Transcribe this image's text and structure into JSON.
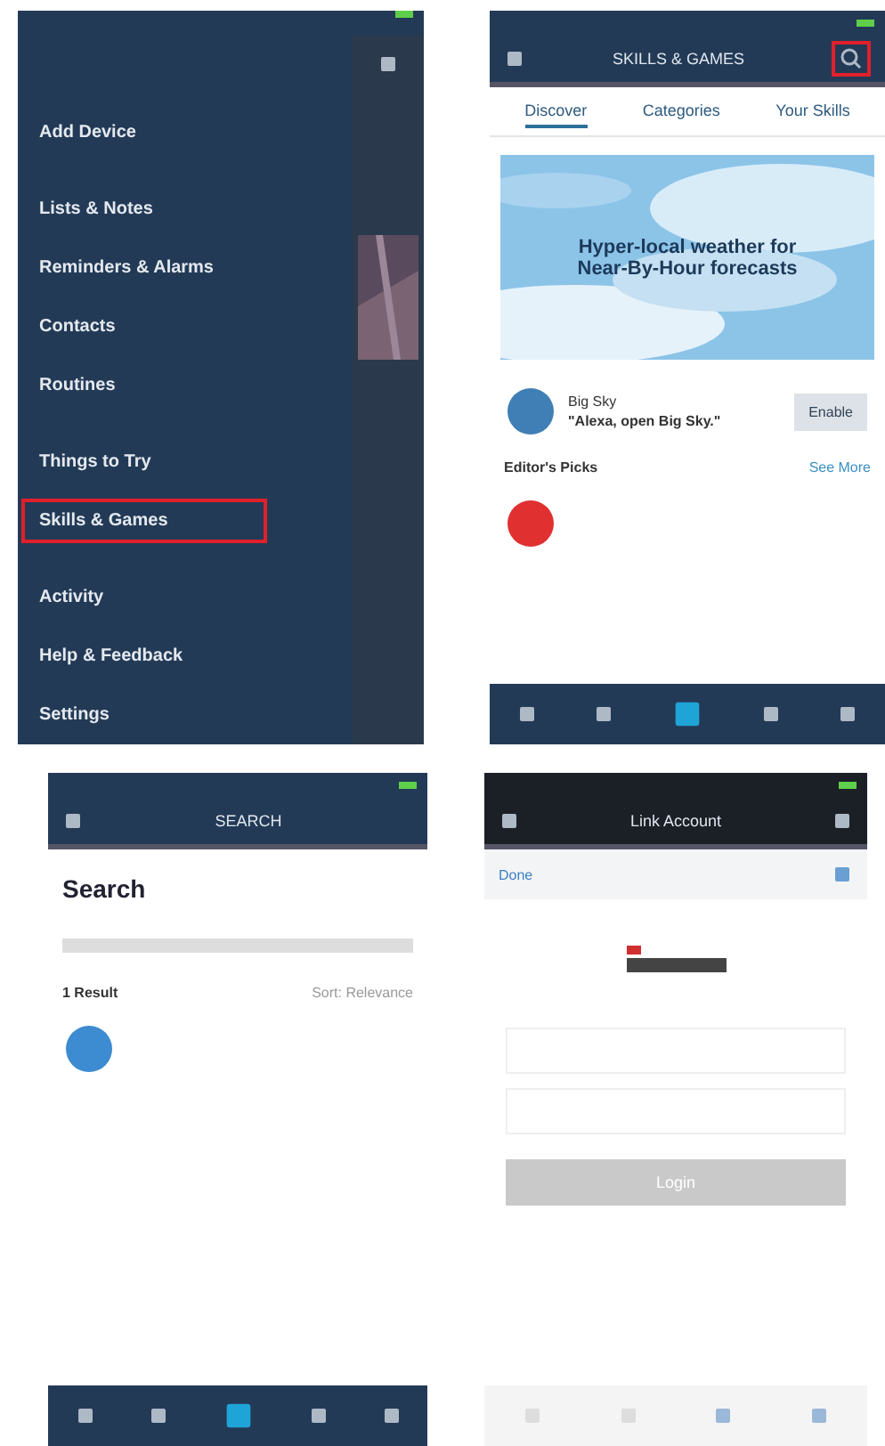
{
  "menu_screen": {
    "items": [
      {
        "label": "Add Device",
        "highlighted": false
      },
      {
        "label": "Lists & Notes",
        "highlighted": false
      },
      {
        "label": "Reminders & Alarms",
        "highlighted": false
      },
      {
        "label": "Contacts",
        "highlighted": false
      },
      {
        "label": "Routines",
        "highlighted": false
      },
      {
        "label": "Things to Try",
        "highlighted": false
      },
      {
        "label": "Skills & Games",
        "highlighted": true
      },
      {
        "label": "Activity",
        "highlighted": false
      },
      {
        "label": "Help & Feedback",
        "highlighted": false
      },
      {
        "label": "Settings",
        "highlighted": false
      }
    ]
  },
  "skills_screen": {
    "title": "SKILLS & GAMES",
    "search_highlighted": true,
    "tabs": [
      {
        "label": "Discover",
        "selected": true
      },
      {
        "label": "Categories",
        "selected": false
      },
      {
        "label": "Your Skills",
        "selected": false
      }
    ],
    "banner": "Hyper-local weather for Near-By-Hour forecasts",
    "featured": {
      "name": "Big Sky",
      "phrase": "\"Alexa, open Big Sky.\"",
      "button": "Enable"
    },
    "section": {
      "title": "Editor's Picks",
      "link": "See More"
    }
  },
  "search_screen": {
    "title": "SEARCH",
    "heading": "Search",
    "result_count": "1 Result",
    "sort": "Sort: Relevance"
  },
  "link_screen": {
    "title": "Link Account",
    "done": "Done",
    "button": "Login"
  }
}
